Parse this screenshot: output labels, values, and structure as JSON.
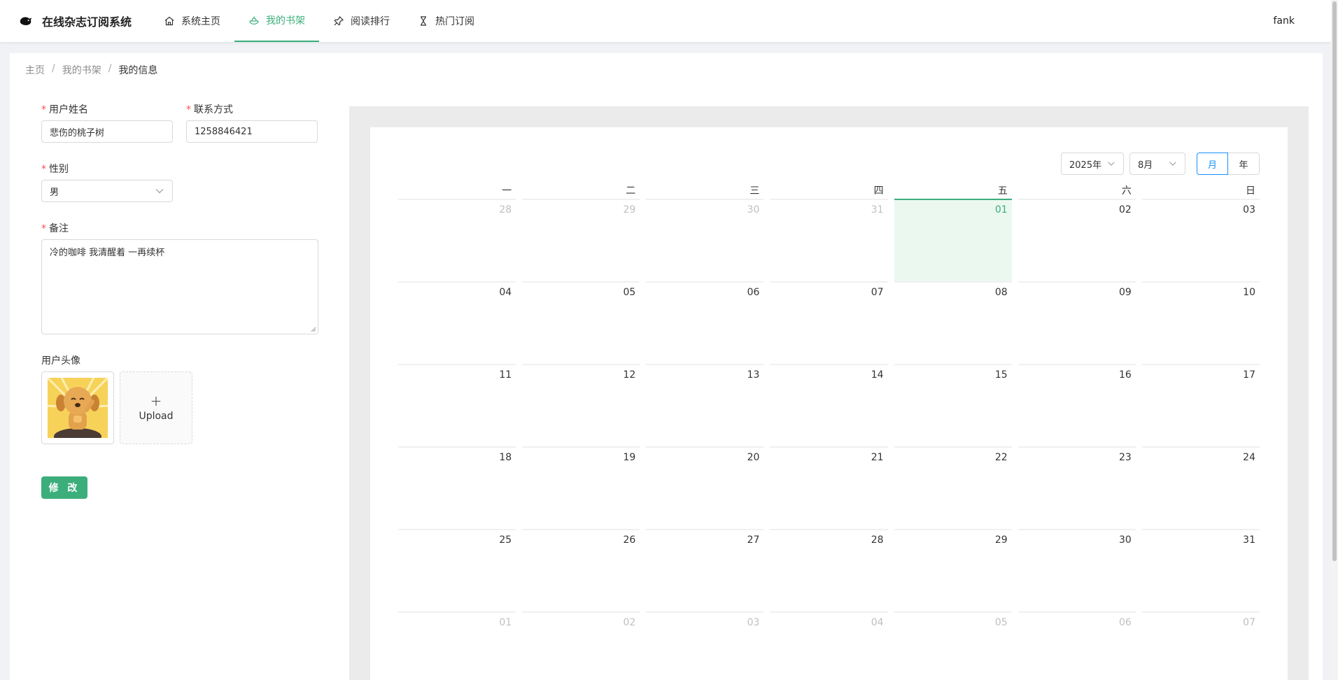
{
  "app": {
    "title": "在线杂志订阅系统",
    "user": "fank"
  },
  "nav": [
    {
      "label": "系统主页",
      "icon": "home-icon",
      "active": false
    },
    {
      "label": "我的书架",
      "icon": "bookshelf-icon",
      "active": true
    },
    {
      "label": "阅读排行",
      "icon": "pin-icon",
      "active": false
    },
    {
      "label": "热门订阅",
      "icon": "hourglass-icon",
      "active": false
    }
  ],
  "breadcrumb": {
    "home": "主页",
    "shelf": "我的书架",
    "current": "我的信息",
    "sep": "/"
  },
  "form": {
    "name_label": "用户姓名",
    "name_value": "悲伤的桃子树",
    "contact_label": "联系方式",
    "contact_value": "1258846421",
    "gender_label": "性别",
    "gender_value": "男",
    "remark_label": "备注",
    "remark_value": "冷的咖啡 我清醒着 一再续杯",
    "avatar_label": "用户头像",
    "upload_plus": "+",
    "upload_label": "Upload",
    "submit_label": "修 改"
  },
  "calendar": {
    "year": "2025年",
    "month": "8月",
    "mode_month": "月",
    "mode_year": "年",
    "weekdays": [
      "一",
      "二",
      "三",
      "四",
      "五",
      "六",
      "日"
    ],
    "weeks": [
      [
        {
          "d": "28",
          "m": true
        },
        {
          "d": "29",
          "m": true
        },
        {
          "d": "30",
          "m": true
        },
        {
          "d": "31",
          "m": true
        },
        {
          "d": "01",
          "today": true
        },
        {
          "d": "02"
        },
        {
          "d": "03"
        }
      ],
      [
        {
          "d": "04"
        },
        {
          "d": "05"
        },
        {
          "d": "06"
        },
        {
          "d": "07"
        },
        {
          "d": "08"
        },
        {
          "d": "09"
        },
        {
          "d": "10"
        }
      ],
      [
        {
          "d": "11"
        },
        {
          "d": "12"
        },
        {
          "d": "13"
        },
        {
          "d": "14"
        },
        {
          "d": "15"
        },
        {
          "d": "16"
        },
        {
          "d": "17"
        }
      ],
      [
        {
          "d": "18"
        },
        {
          "d": "19"
        },
        {
          "d": "20"
        },
        {
          "d": "21"
        },
        {
          "d": "22"
        },
        {
          "d": "23"
        },
        {
          "d": "24"
        }
      ],
      [
        {
          "d": "25"
        },
        {
          "d": "26"
        },
        {
          "d": "27"
        },
        {
          "d": "28"
        },
        {
          "d": "29"
        },
        {
          "d": "30"
        },
        {
          "d": "31"
        }
      ],
      [
        {
          "d": "01",
          "m": true
        },
        {
          "d": "02",
          "m": true
        },
        {
          "d": "03",
          "m": true
        },
        {
          "d": "04",
          "m": true
        },
        {
          "d": "05",
          "m": true
        },
        {
          "d": "06",
          "m": true
        },
        {
          "d": "07",
          "m": true
        }
      ]
    ]
  },
  "colors": {
    "accent": "#3cae7b",
    "link": "#1890ff",
    "required": "#ff4d4f"
  }
}
